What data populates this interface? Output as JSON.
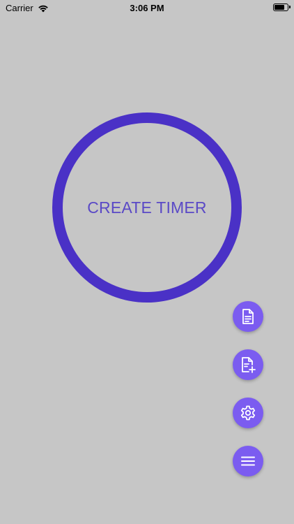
{
  "status_bar": {
    "carrier": "Carrier",
    "time": "3:06 PM",
    "battery_level": 0.85
  },
  "main": {
    "timer_label": "CREATE TIMER"
  },
  "actions": [
    {
      "icon": "document-icon"
    },
    {
      "icon": "document-add-icon"
    },
    {
      "icon": "gear-icon"
    },
    {
      "icon": "menu-icon"
    }
  ],
  "colors": {
    "background": "#c6c6c6",
    "ring": "#4a31c6",
    "label": "#5a49c6",
    "fab": "#7b5cf0"
  }
}
